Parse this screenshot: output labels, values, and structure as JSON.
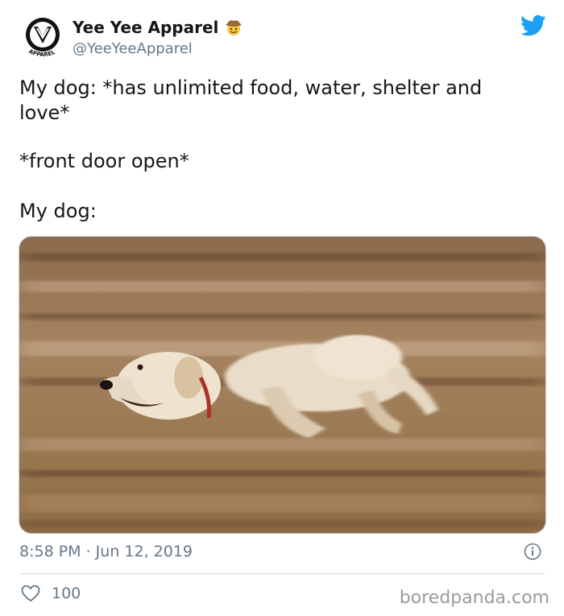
{
  "tweet": {
    "display_name": "Yee Yee Apparel",
    "handle": "@YeeYeeApparel",
    "avatar_logo_text": "APPAREL",
    "name_emoji": "cowboy-face-emoji",
    "body": {
      "line1": "My dog: *has unlimited food, water, shelter and love*",
      "line2": "*front door open*",
      "line3": "My dog:"
    },
    "media": {
      "subject": "dog-running-photo"
    },
    "timestamp": "8:58 PM · Jun 12, 2019",
    "like_count": "100"
  },
  "icons": {
    "platform": "twitter-bird-icon",
    "info": "info-icon",
    "like": "heart-icon"
  },
  "colors": {
    "twitter_blue": "#1DA1F2",
    "secondary_text": "#657786",
    "divider": "#CCD6DD"
  },
  "watermark": "boredpanda.com"
}
